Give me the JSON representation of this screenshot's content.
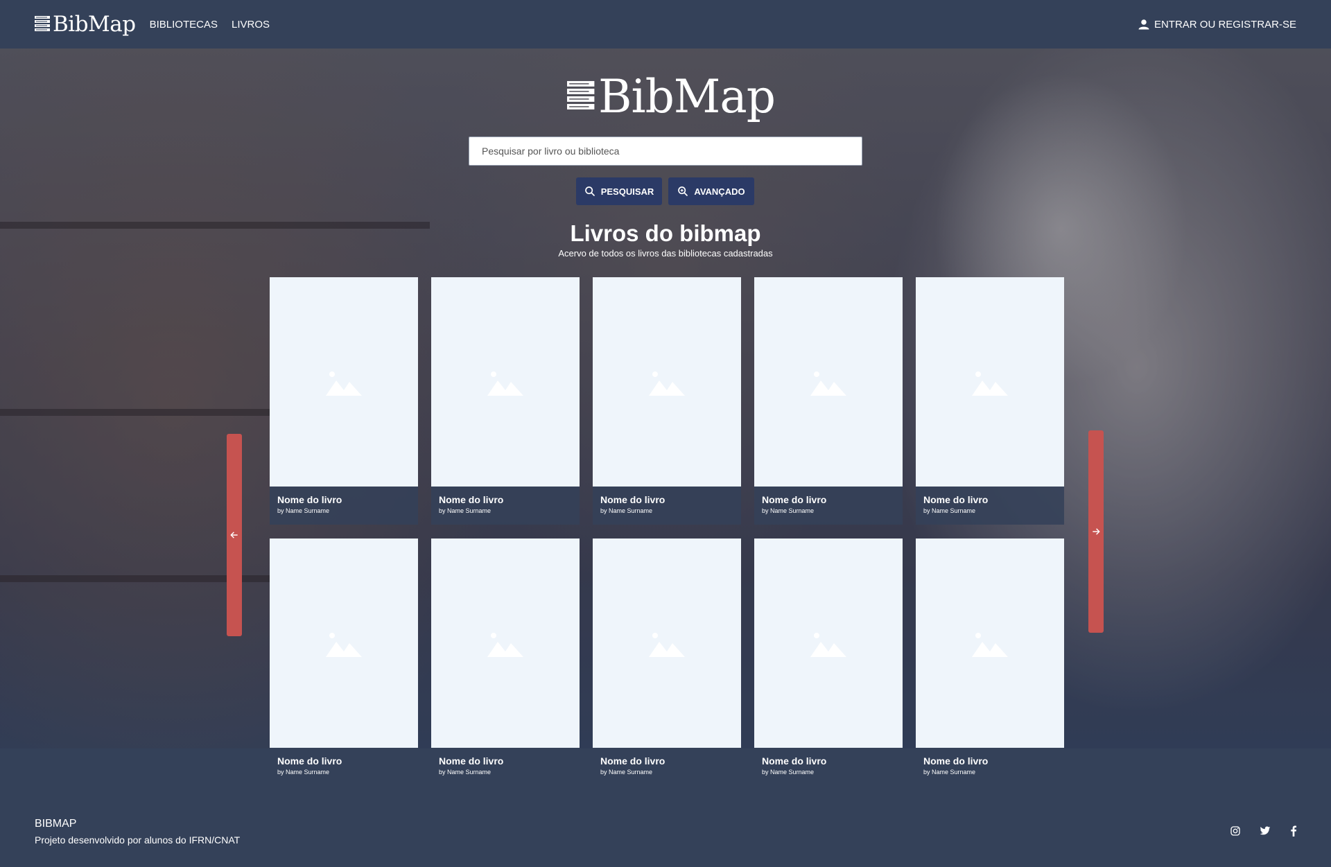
{
  "navbar": {
    "logo_text": "BibMap",
    "links": [
      "BIBLIOTECAS",
      "LIVROS"
    ],
    "login_label": "ENTRAR OU REGISTRAR-SE"
  },
  "hero": {
    "logo_text": "BibMap",
    "search_placeholder": "Pesquisar por livro ou biblioteca",
    "search_button": "PESQUISAR",
    "advanced_button": "AVANÇADO",
    "section_title": "Livros do bibmap",
    "section_subtitle": "Acervo de todos os livros das bibliotecas cadastradas"
  },
  "books": [
    {
      "title": "Nome do livro",
      "author": "by Name Surname"
    },
    {
      "title": "Nome do livro",
      "author": "by Name Surname"
    },
    {
      "title": "Nome do livro",
      "author": "by Name Surname"
    },
    {
      "title": "Nome do livro",
      "author": "by Name Surname"
    },
    {
      "title": "Nome do livro",
      "author": "by Name Surname"
    },
    {
      "title": "Nome do livro",
      "author": "by Name Surname"
    },
    {
      "title": "Nome do livro",
      "author": "by Name Surname"
    },
    {
      "title": "Nome do livro",
      "author": "by Name Surname"
    },
    {
      "title": "Nome do livro",
      "author": "by Name Surname"
    },
    {
      "title": "Nome do livro",
      "author": "by Name Surname"
    }
  ],
  "footer": {
    "title": "BIBMAP",
    "description": "Projeto desenvolvido por alunos do IFRN/CNAT",
    "social": [
      "instagram-icon",
      "twitter-icon",
      "facebook-icon"
    ]
  },
  "colors": {
    "navy": "#344159",
    "button": "#2b3a66",
    "arrow": "#c65350",
    "card_bg": "#eff5fb"
  }
}
